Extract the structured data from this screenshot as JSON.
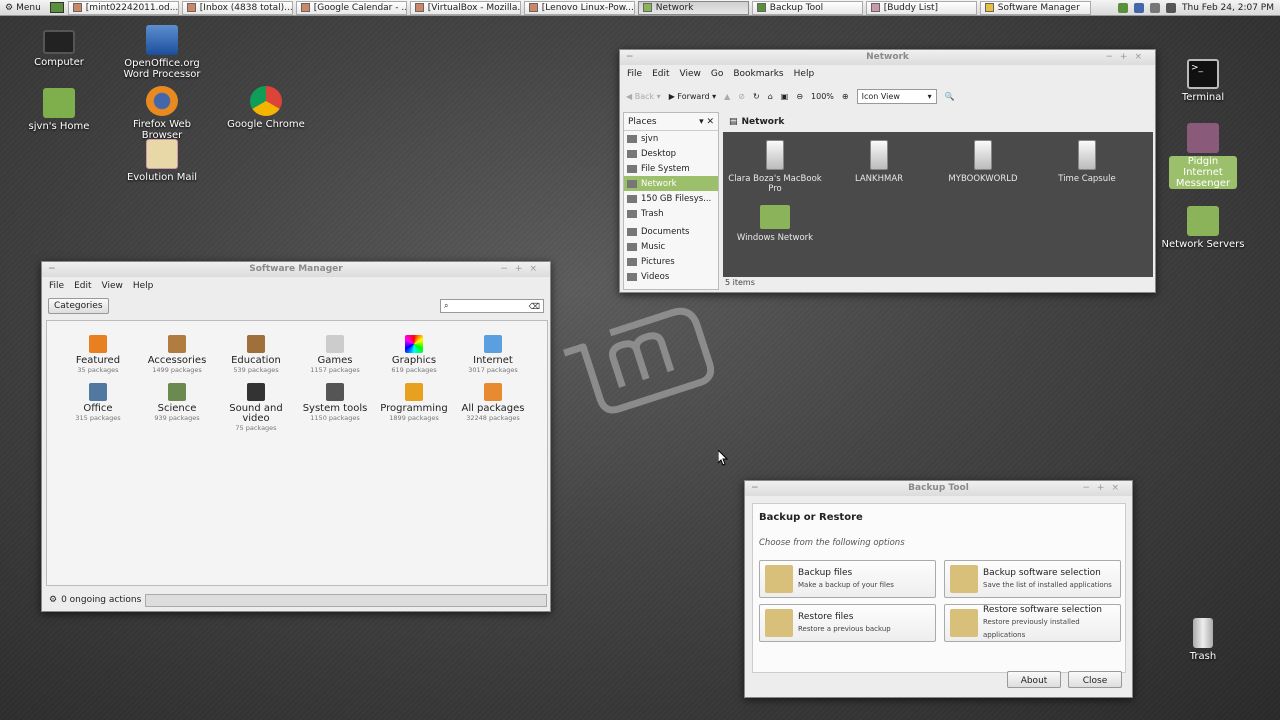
{
  "panel": {
    "menu_label": "Menu",
    "tasks": [
      {
        "label": "[mint02242011.od..."
      },
      {
        "label": "[Inbox (4838 total)..."
      },
      {
        "label": "[Google Calendar - ..."
      },
      {
        "label": "[VirtualBox - Mozilla..."
      },
      {
        "label": "[Lenovo Linux-Pow..."
      },
      {
        "label": "Network"
      },
      {
        "label": "Backup Tool"
      },
      {
        "label": "[Buddy List]"
      },
      {
        "label": "Software Manager"
      }
    ],
    "clock": "Thu Feb 24,  2:07 PM"
  },
  "desktop": {
    "computer": "Computer",
    "oo_line1": "OpenOffice.org",
    "oo_line2": "Word Processor",
    "home": "sjvn's Home",
    "firefox": "Firefox Web Browser",
    "chrome": "Google Chrome",
    "evolution": "Evolution Mail",
    "terminal": "Terminal",
    "pidgin_line1": "Pidgin Internet",
    "pidgin_line2": "Messenger",
    "netservers": "Network Servers",
    "trash": "Trash"
  },
  "network": {
    "title": "Network",
    "menu": [
      "File",
      "Edit",
      "View",
      "Go",
      "Bookmarks",
      "Help"
    ],
    "back": "Back",
    "forward": "Forward",
    "zoom": "100%",
    "view_mode": "Icon View",
    "places_label": "Places",
    "places": [
      "sjvn",
      "Desktop",
      "File System",
      "Network",
      "150 GB Filesys...",
      "Trash",
      "Documents",
      "Music",
      "Pictures",
      "Videos"
    ],
    "location": "Network",
    "items": [
      "Clara Boza's MacBook Pro",
      "LANKHMAR",
      "MYBOOKWORLD",
      "Time Capsule",
      "Windows Network"
    ],
    "status": "5 items"
  },
  "software": {
    "title": "Software Manager",
    "menu": [
      "File",
      "Edit",
      "View",
      "Help"
    ],
    "categories_button": "Categories",
    "cats": [
      {
        "name": "Featured",
        "count": "35 packages"
      },
      {
        "name": "Accessories",
        "count": "1499 packages"
      },
      {
        "name": "Education",
        "count": "539 packages"
      },
      {
        "name": "Games",
        "count": "1157 packages"
      },
      {
        "name": "Graphics",
        "count": "619 packages"
      },
      {
        "name": "Internet",
        "count": "3017 packages"
      },
      {
        "name": "Office",
        "count": "315 packages"
      },
      {
        "name": "Science",
        "count": "939 packages"
      },
      {
        "name": "Sound and video",
        "count": "75 packages"
      },
      {
        "name": "System tools",
        "count": "1150 packages"
      },
      {
        "name": "Programming",
        "count": "1899 packages"
      },
      {
        "name": "All packages",
        "count": "32248 packages"
      }
    ],
    "status": "0 ongoing actions"
  },
  "backup": {
    "title": "Backup Tool",
    "heading": "Backup or Restore",
    "subtitle": "Choose from the following options",
    "options": [
      {
        "title": "Backup files",
        "desc": "Make a backup of your files"
      },
      {
        "title": "Backup software selection",
        "desc": "Save the list of installed applications"
      },
      {
        "title": "Restore files",
        "desc": "Restore a previous backup"
      },
      {
        "title": "Restore software selection",
        "desc": "Restore previously installed applications"
      }
    ],
    "about": "About",
    "close": "Close"
  },
  "colors": {
    "accent": "#9cbf6b",
    "desktop": "#444444"
  }
}
